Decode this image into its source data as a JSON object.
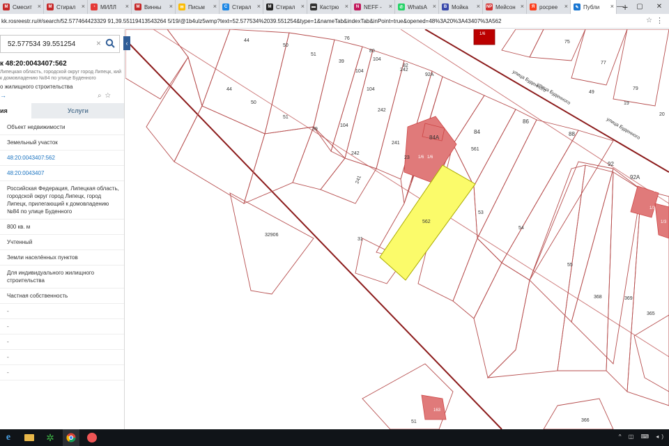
{
  "browser": {
    "tabs": [
      {
        "label": "Смесит",
        "icon": "M",
        "color": "#c62828"
      },
      {
        "label": "Стирал",
        "icon": "M",
        "color": "#c62828"
      },
      {
        "label": "МИЛЛ",
        "icon": "◔",
        "color": "#e53935"
      },
      {
        "label": "Винны",
        "icon": "M",
        "color": "#c62828"
      },
      {
        "label": "Письм",
        "icon": "✉",
        "color": "#fbbc04"
      },
      {
        "label": "Стирал",
        "icon": "C",
        "color": "#1e88e5"
      },
      {
        "label": "Стирал",
        "icon": "M",
        "color": "#222222"
      },
      {
        "label": "Кастрю",
        "icon": "▬",
        "color": "#333333"
      },
      {
        "label": "NEFF -",
        "icon": "N",
        "color": "#c2185b"
      },
      {
        "label": "WhatsA",
        "icon": "✆",
        "color": "#25d366"
      },
      {
        "label": "Мойка",
        "icon": "B",
        "color": "#3949ab"
      },
      {
        "label": "Мейсон",
        "icon": "NP",
        "color": "#d32f2f"
      },
      {
        "label": "росрее",
        "icon": "Я",
        "color": "#fc3f1d"
      },
      {
        "label": "Публи",
        "icon": "✎",
        "color": "#1976d2"
      }
    ],
    "new_tab": "+",
    "url": "kk.rosreestr.ru/#/search/52.577464423329 91,39.55119413543264 5/19/@1b4ulz5wmp?text=52.577534%2039.551254&type=1&nameTab&indexTab&inPoint=true&opened=48%3A20%3A43407%3A562"
  },
  "sidebar": {
    "search_value": "52.577534 39.551254",
    "title": "к 48:20:0043407:562",
    "address": "Липецкая область, городской округ город Липецк, кий к домовладению №84 по улице Буденного",
    "purpose": "о жилищного строительства",
    "link_arrow": "→",
    "tab_info": "ия",
    "tab_services": "Услуги",
    "rows": [
      {
        "text": "Объект недвижимости",
        "type": "text"
      },
      {
        "text": "Земельный участок",
        "type": "text"
      },
      {
        "text": "48:20:0043407:562",
        "type": "link"
      },
      {
        "text": "48:20:0043407",
        "type": "link"
      },
      {
        "text": "Российская Федерация, Липецкая область, городской округ город Липецк, город Липецк, прилегающий к домовладению №84 по улице Буденного",
        "type": "text"
      },
      {
        "text": "800 кв. м",
        "type": "text"
      },
      {
        "text": "Учтенный",
        "type": "text"
      },
      {
        "text": "Земли населённых пунктов",
        "type": "text"
      },
      {
        "text": "Для индивидуального жилищного строительства",
        "type": "text"
      },
      {
        "text": "Частная собственность",
        "type": "text"
      },
      {
        "text": "-",
        "type": "dash"
      },
      {
        "text": "-",
        "type": "dash"
      },
      {
        "text": "-",
        "type": "dash"
      },
      {
        "text": "-",
        "type": "dash"
      },
      {
        "text": "-",
        "type": "dash"
      }
    ]
  },
  "map": {
    "street1": "улица Буденного",
    "street2": "улица Буденного",
    "street3": "улица Буденного",
    "labels": {
      "l44a": "44",
      "l50a": "50",
      "l51a": "51",
      "l76": "76",
      "l80": "80",
      "l104a": "104",
      "l82": "82",
      "l242a": "242",
      "l39a": "39",
      "l104b": "104",
      "l104c": "104",
      "l92a_top": "92А",
      "l75": "75",
      "l77": "77",
      "l79": "79",
      "l44b": "44",
      "l50b": "50",
      "l51b": "51",
      "l39b": "39",
      "l242b": "242",
      "l49": "49",
      "l19": "19",
      "l20": "20",
      "l84a": "84А",
      "l84": "84",
      "l86": "86",
      "l88": "88",
      "l241a": "241",
      "l242c": "242",
      "l241b": "241",
      "l561": "561",
      "l23": "23",
      "l1kb": "1/6",
      "l1kc": "1/6",
      "l92": "92",
      "l92a": "92А",
      "l562": "562",
      "l53": "53",
      "l54": "54",
      "l55": "55",
      "l32906": "32906",
      "l31": "31",
      "l368": "368",
      "l369": "369",
      "l365": "365",
      "l366": "366",
      "l51c": "51",
      "l163": "163",
      "l1kd": "1/6",
      "l1ke": "1/3",
      "l1kf": "1/3",
      "l1top": "1/6"
    }
  },
  "taskbar": {
    "tray": "^ ◫ ⌨ ◂)"
  }
}
